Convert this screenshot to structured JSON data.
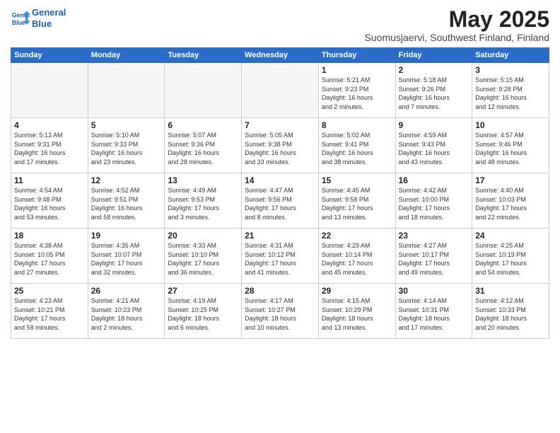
{
  "header": {
    "logo_line1": "General",
    "logo_line2": "Blue",
    "month": "May 2025",
    "location": "Suomusjaervi, Southwest Finland, Finland"
  },
  "weekdays": [
    "Sunday",
    "Monday",
    "Tuesday",
    "Wednesday",
    "Thursday",
    "Friday",
    "Saturday"
  ],
  "weeks": [
    [
      {
        "day": "",
        "info": ""
      },
      {
        "day": "",
        "info": ""
      },
      {
        "day": "",
        "info": ""
      },
      {
        "day": "",
        "info": ""
      },
      {
        "day": "1",
        "info": "Sunrise: 5:21 AM\nSunset: 9:23 PM\nDaylight: 16 hours\nand 2 minutes."
      },
      {
        "day": "2",
        "info": "Sunrise: 5:18 AM\nSunset: 9:26 PM\nDaylight: 16 hours\nand 7 minutes."
      },
      {
        "day": "3",
        "info": "Sunrise: 5:15 AM\nSunset: 9:28 PM\nDaylight: 16 hours\nand 12 minutes."
      }
    ],
    [
      {
        "day": "4",
        "info": "Sunrise: 5:13 AM\nSunset: 9:31 PM\nDaylight: 16 hours\nand 17 minutes."
      },
      {
        "day": "5",
        "info": "Sunrise: 5:10 AM\nSunset: 9:33 PM\nDaylight: 16 hours\nand 23 minutes."
      },
      {
        "day": "6",
        "info": "Sunrise: 5:07 AM\nSunset: 9:36 PM\nDaylight: 16 hours\nand 28 minutes."
      },
      {
        "day": "7",
        "info": "Sunrise: 5:05 AM\nSunset: 9:38 PM\nDaylight: 16 hours\nand 33 minutes."
      },
      {
        "day": "8",
        "info": "Sunrise: 5:02 AM\nSunset: 9:41 PM\nDaylight: 16 hours\nand 38 minutes."
      },
      {
        "day": "9",
        "info": "Sunrise: 4:59 AM\nSunset: 9:43 PM\nDaylight: 16 hours\nand 43 minutes."
      },
      {
        "day": "10",
        "info": "Sunrise: 4:57 AM\nSunset: 9:46 PM\nDaylight: 16 hours\nand 48 minutes."
      }
    ],
    [
      {
        "day": "11",
        "info": "Sunrise: 4:54 AM\nSunset: 9:48 PM\nDaylight: 16 hours\nand 53 minutes."
      },
      {
        "day": "12",
        "info": "Sunrise: 4:52 AM\nSunset: 9:51 PM\nDaylight: 16 hours\nand 58 minutes."
      },
      {
        "day": "13",
        "info": "Sunrise: 4:49 AM\nSunset: 9:53 PM\nDaylight: 17 hours\nand 3 minutes."
      },
      {
        "day": "14",
        "info": "Sunrise: 4:47 AM\nSunset: 9:56 PM\nDaylight: 17 hours\nand 8 minutes."
      },
      {
        "day": "15",
        "info": "Sunrise: 4:45 AM\nSunset: 9:58 PM\nDaylight: 17 hours\nand 13 minutes."
      },
      {
        "day": "16",
        "info": "Sunrise: 4:42 AM\nSunset: 10:00 PM\nDaylight: 17 hours\nand 18 minutes."
      },
      {
        "day": "17",
        "info": "Sunrise: 4:40 AM\nSunset: 10:03 PM\nDaylight: 17 hours\nand 22 minutes."
      }
    ],
    [
      {
        "day": "18",
        "info": "Sunrise: 4:38 AM\nSunset: 10:05 PM\nDaylight: 17 hours\nand 27 minutes."
      },
      {
        "day": "19",
        "info": "Sunrise: 4:35 AM\nSunset: 10:07 PM\nDaylight: 17 hours\nand 32 minutes."
      },
      {
        "day": "20",
        "info": "Sunrise: 4:33 AM\nSunset: 10:10 PM\nDaylight: 17 hours\nand 36 minutes."
      },
      {
        "day": "21",
        "info": "Sunrise: 4:31 AM\nSunset: 10:12 PM\nDaylight: 17 hours\nand 41 minutes."
      },
      {
        "day": "22",
        "info": "Sunrise: 4:29 AM\nSunset: 10:14 PM\nDaylight: 17 hours\nand 45 minutes."
      },
      {
        "day": "23",
        "info": "Sunrise: 4:27 AM\nSunset: 10:17 PM\nDaylight: 17 hours\nand 49 minutes."
      },
      {
        "day": "24",
        "info": "Sunrise: 4:25 AM\nSunset: 10:19 PM\nDaylight: 17 hours\nand 54 minutes."
      }
    ],
    [
      {
        "day": "25",
        "info": "Sunrise: 4:23 AM\nSunset: 10:21 PM\nDaylight: 17 hours\nand 58 minutes."
      },
      {
        "day": "26",
        "info": "Sunrise: 4:21 AM\nSunset: 10:23 PM\nDaylight: 18 hours\nand 2 minutes."
      },
      {
        "day": "27",
        "info": "Sunrise: 4:19 AM\nSunset: 10:25 PM\nDaylight: 18 hours\nand 6 minutes."
      },
      {
        "day": "28",
        "info": "Sunrise: 4:17 AM\nSunset: 10:27 PM\nDaylight: 18 hours\nand 10 minutes."
      },
      {
        "day": "29",
        "info": "Sunrise: 4:15 AM\nSunset: 10:29 PM\nDaylight: 18 hours\nand 13 minutes."
      },
      {
        "day": "30",
        "info": "Sunrise: 4:14 AM\nSunset: 10:31 PM\nDaylight: 18 hours\nand 17 minutes."
      },
      {
        "day": "31",
        "info": "Sunrise: 4:12 AM\nSunset: 10:33 PM\nDaylight: 18 hours\nand 20 minutes."
      }
    ]
  ]
}
